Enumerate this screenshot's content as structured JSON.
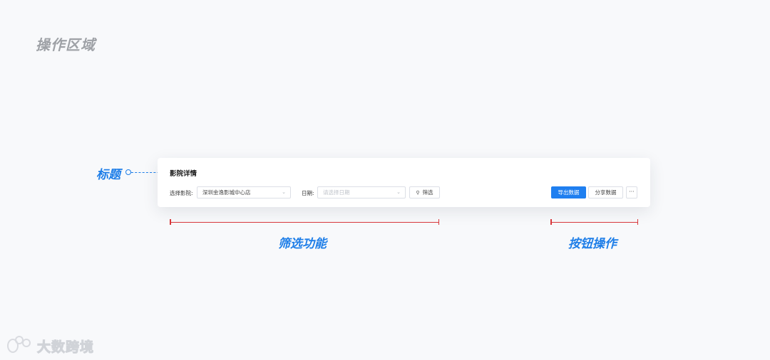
{
  "section_title": "操作区域",
  "annotations": {
    "title": "标题",
    "filter": "筛选功能",
    "buttons": "按钮操作"
  },
  "panel": {
    "title": "影院详情",
    "cinema_label": "选择影院:",
    "cinema_value": "深圳金逸影城中心店",
    "date_label": "日期:",
    "date_placeholder": "请选择日期",
    "filter_button": "筛选",
    "export_button": "导出数据",
    "share_button": "分享数据",
    "more_button": "···"
  },
  "watermark": "大数跨境",
  "colors": {
    "accent": "#1e7ee8",
    "primary_button": "#1f7ff0",
    "bracket": "#d8373b"
  }
}
